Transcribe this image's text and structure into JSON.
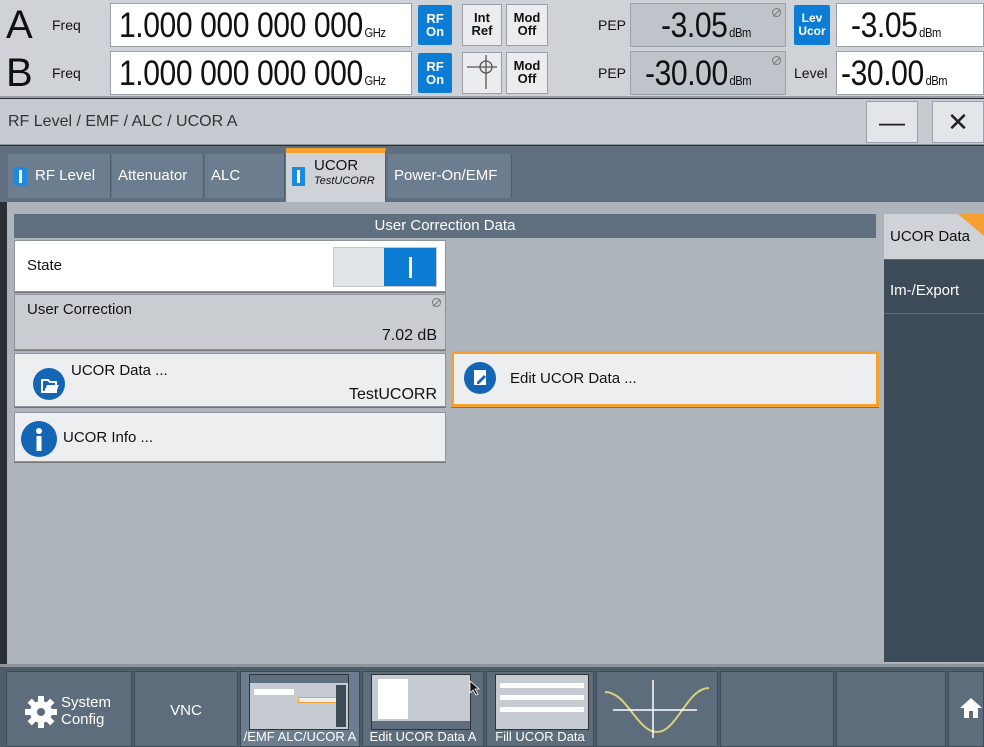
{
  "topbar": {
    "rowA": {
      "letter": "A",
      "freq_label": "Freq",
      "freq_value": "1.000 000 000 000",
      "freq_unit": "GHz",
      "rf": "RF",
      "rf_state": "On",
      "ref": "Int",
      "ref2": "Ref",
      "mod": "Mod",
      "mod_state": "Off",
      "pep_label": "PEP",
      "pep_value": "-3.05",
      "pep_unit": "dBm",
      "lev": "Lev",
      "lev2": "Ucor",
      "level_value": "-3.05",
      "level_unit": "dBm"
    },
    "rowB": {
      "letter": "B",
      "freq_label": "Freq",
      "freq_value": "1.000 000 000 000",
      "freq_unit": "GHz",
      "rf": "RF",
      "rf_state": "On",
      "mod": "Mod",
      "mod_state": "Off",
      "pep_label": "PEP",
      "pep_value": "-30.00",
      "pep_unit": "dBm",
      "level_label": "Level",
      "level_value": "-30.00",
      "level_unit": "dBm"
    },
    "accent_blue": "#0c7cd5"
  },
  "dialog": {
    "title": "RF Level / EMF / ALC / UCOR A",
    "minimize": "—",
    "close": "✕",
    "tabs": [
      {
        "label": "RF Level"
      },
      {
        "label": "Attenuator"
      },
      {
        "label": "ALC"
      },
      {
        "label": "UCOR",
        "sub": "TestUCORR"
      },
      {
        "label": "Power-On/EMF"
      }
    ],
    "section_header": "User Correction Data",
    "state_label": "State",
    "user_correction_label": "User Correction",
    "user_correction_value": "7.02 dB",
    "ucor_data_label": "UCOR Data ...",
    "ucor_data_value": "TestUCORR",
    "edit_label": "Edit UCOR Data ...",
    "info_label": "UCOR Info ...",
    "side_tabs": [
      {
        "label": "UCOR Data"
      },
      {
        "label": "Im-/Export"
      }
    ],
    "highlight": "#f5a030"
  },
  "taskbar": {
    "system_config": "System Config",
    "system_config_line1": "System",
    "system_config_line2": "Config",
    "vnc": "VNC",
    "thumbs": [
      {
        "label": "/EMF ALC/UCOR A"
      },
      {
        "label": "Edit UCOR  Data A"
      },
      {
        "label": "Fill UCOR  Data"
      }
    ]
  }
}
